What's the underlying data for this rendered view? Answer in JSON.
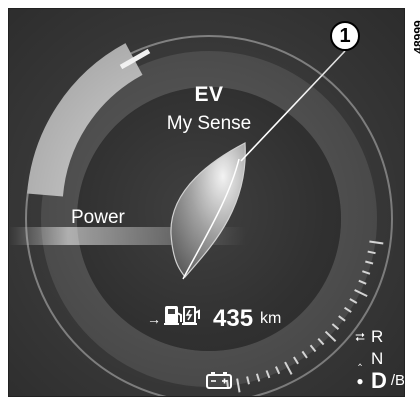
{
  "dashboard": {
    "mode_title": "EV",
    "mode_subtitle": "My Sense",
    "power_label": "Power",
    "range_value": "435",
    "range_unit": "km",
    "arrow_glyph": "→",
    "icons": [
      "fuel-pump-icon",
      "charging-station-icon",
      "battery-icon",
      "eco-leaf-icon"
    ]
  },
  "gear_selector": {
    "items": [
      {
        "label": "R",
        "icon": "double-chevron-up-icon"
      },
      {
        "label": "N",
        "icon": "chevron-up-icon"
      },
      {
        "label": "D",
        "suffix": "/B",
        "icon": "dot-chevron-down-icon",
        "active": true
      }
    ]
  },
  "annotations": {
    "callout_number": "1",
    "reference_code": "48999"
  },
  "colors": {
    "screen_bg": "#3b3b3b",
    "ring_inner": "#4a4a4a",
    "power_arc": "#bdbdbd",
    "text": "#ffffff"
  }
}
